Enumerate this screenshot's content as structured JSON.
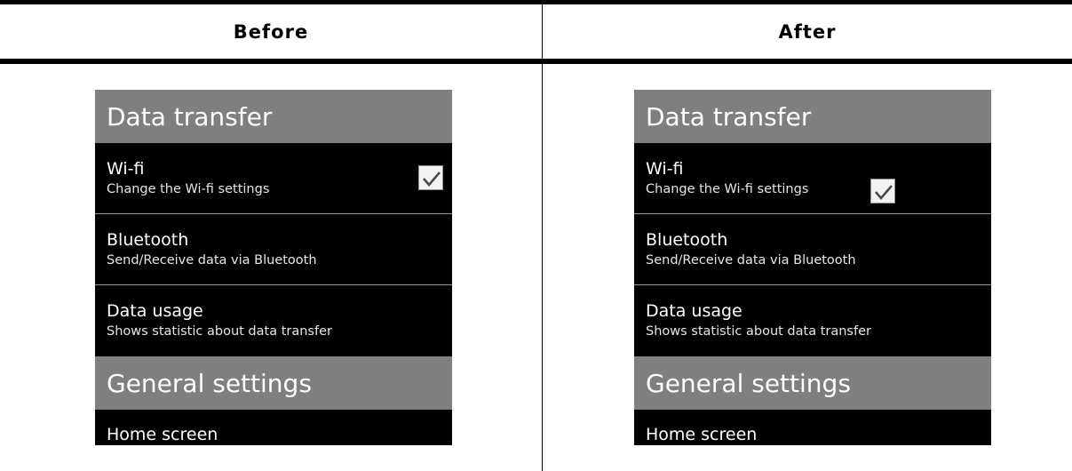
{
  "columns": {
    "before": "Before",
    "after": "After"
  },
  "panels": {
    "before": {
      "header1": "Data transfer",
      "items": [
        {
          "title": "Wi-fi",
          "subtitle": "Change the Wi-fi settings",
          "checked": true
        },
        {
          "title": "Bluetooth",
          "subtitle": "Send/Receive data via Bluetooth"
        },
        {
          "title": "Data usage",
          "subtitle": "Shows statistic about data transfer"
        }
      ],
      "header2": "General settings",
      "partial_item": "Home screen"
    },
    "after": {
      "header1": "Data transfer",
      "items": [
        {
          "title": "Wi-fi",
          "subtitle": "Change the Wi-fi settings",
          "checked": true
        },
        {
          "title": "Bluetooth",
          "subtitle": "Send/Receive data via Bluetooth"
        },
        {
          "title": "Data usage",
          "subtitle": "Shows statistic about data transfer"
        }
      ],
      "header2": "General settings",
      "partial_item": "Home screen"
    }
  },
  "colors": {
    "header_bg": "#7f7f7f",
    "item_bg": "#000000",
    "text": "#ffffff",
    "checkmark": "#4a4a4a"
  },
  "icons": {
    "checkbox": "checkmark-icon"
  }
}
